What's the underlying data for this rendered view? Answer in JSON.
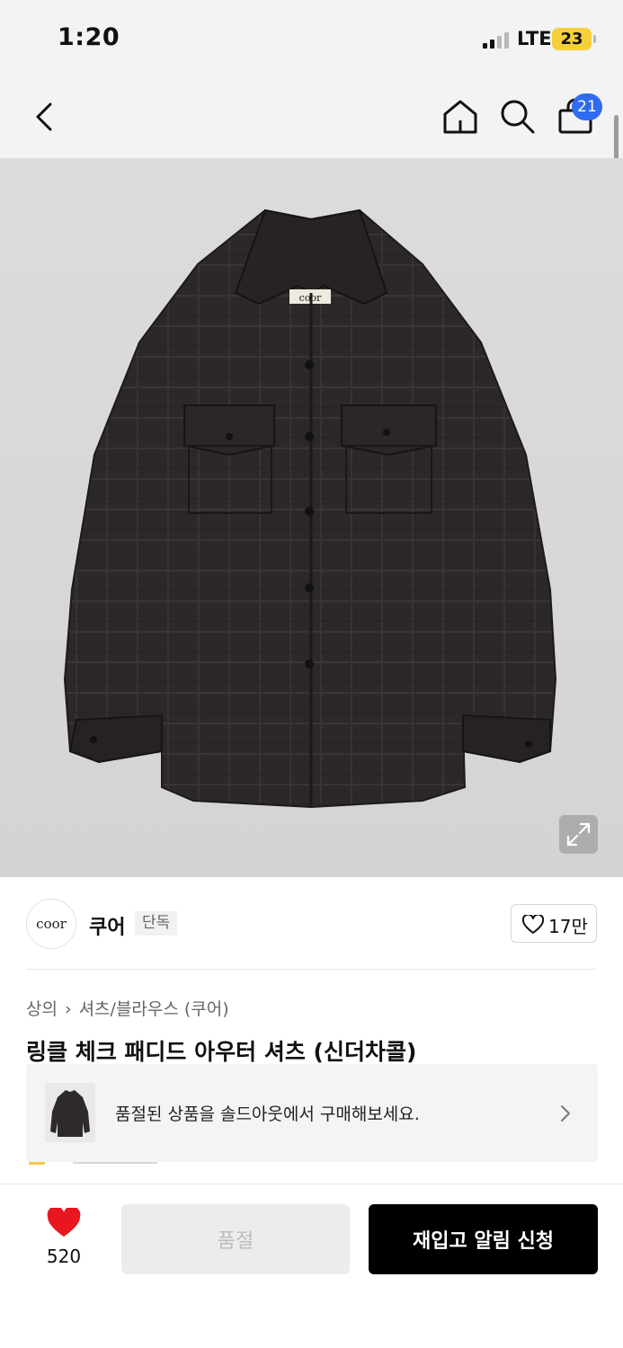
{
  "status_bar": {
    "time": "1:20",
    "network": "LTE",
    "battery": "23"
  },
  "top_nav": {
    "cart_count": "21",
    "icons": [
      "back-arrow-icon",
      "home-icon",
      "search-icon",
      "shopping-bag-icon"
    ]
  },
  "product": {
    "image_label": "coor",
    "brand": {
      "logo_text": "coor",
      "name": "쿠어",
      "tag": "단독",
      "likes": "17만"
    },
    "breadcrumb": [
      "상의",
      "셔츠/블라우스 (쿠어)"
    ],
    "title": "링클 체크 패디드 아우터 셔츠 (신더차콜)"
  },
  "soldout_banner": {
    "text": "품절된 상품을 솔드아웃에서 구매해보세요."
  },
  "bottom_bar": {
    "wish_count": "520",
    "soldout_label": "품절",
    "restock_label": "재입고 알림 신청"
  },
  "colors": {
    "accent_blue": "#2f6bf0",
    "heart_red": "#e8161f",
    "battery_yellow": "#f5d03b",
    "primary_button": "#000000"
  }
}
